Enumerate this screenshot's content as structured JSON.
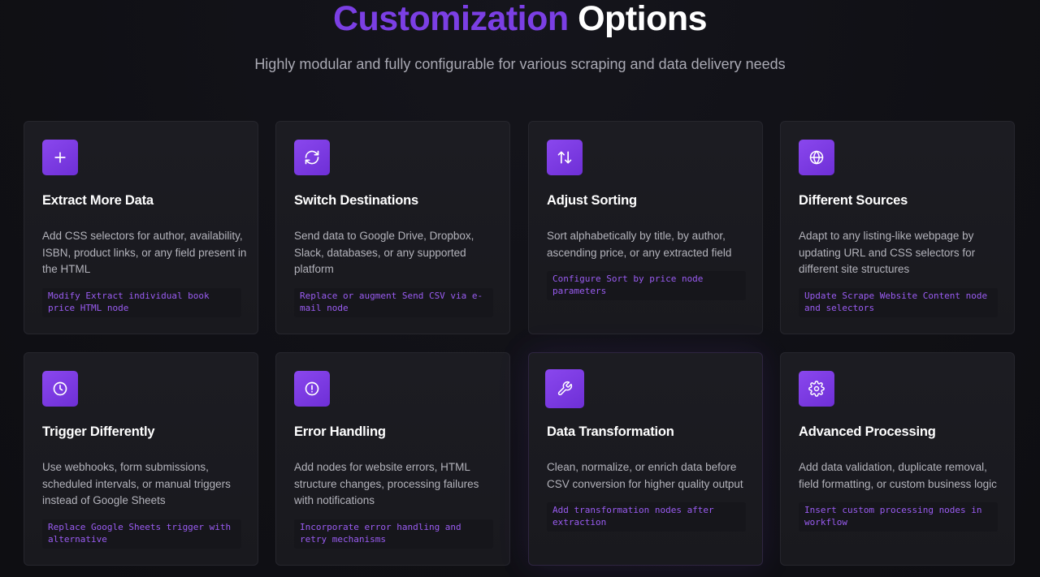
{
  "header": {
    "title_accent": "Customization",
    "title_rest": "Options",
    "subtitle": "Highly modular and fully configurable for various scraping and data delivery needs"
  },
  "colors": {
    "accent": "#7b3fe4",
    "background": "#0f0f14",
    "card": "#1c1c22",
    "code_text": "#9a5cf2"
  },
  "cards": [
    {
      "icon": "plus-icon",
      "title": "Extract More Data",
      "description": "Add CSS selectors for author, availability, ISBN, product links, or any field present in the HTML",
      "code": "Modify Extract individual book price HTML node"
    },
    {
      "icon": "refresh-icon",
      "title": "Switch Destinations",
      "description": "Send data to Google Drive, Dropbox, Slack, databases, or any supported platform",
      "code": "Replace or augment Send CSV via e-mail node"
    },
    {
      "icon": "sort-arrows-icon",
      "title": "Adjust Sorting",
      "description": "Sort alphabetically by title, by author, ascending price, or any extracted field",
      "code": "Configure Sort by price node parameters"
    },
    {
      "icon": "globe-icon",
      "title": "Different Sources",
      "description": "Adapt to any listing-like webpage by updating URL and CSS selectors for different site structures",
      "code": "Update Scrape Website Content node and selectors"
    },
    {
      "icon": "clock-icon",
      "title": "Trigger Differently",
      "description": "Use webhooks, form submissions, scheduled intervals, or manual triggers instead of Google Sheets",
      "code": "Replace Google Sheets trigger with alternative"
    },
    {
      "icon": "alert-icon",
      "title": "Error Handling",
      "description": "Add nodes for website errors, HTML structure changes, processing failures with notifications",
      "code": "Incorporate error handling and retry mechanisms"
    },
    {
      "icon": "wrench-icon",
      "title": "Data Transformation",
      "description": "Clean, normalize, or enrich data before CSV conversion for higher quality output",
      "code": "Add transformation nodes after extraction"
    },
    {
      "icon": "gear-icon",
      "title": "Advanced Processing",
      "description": "Add data validation, duplicate removal, field formatting, or custom business logic",
      "code": "Insert custom processing nodes in workflow"
    }
  ]
}
